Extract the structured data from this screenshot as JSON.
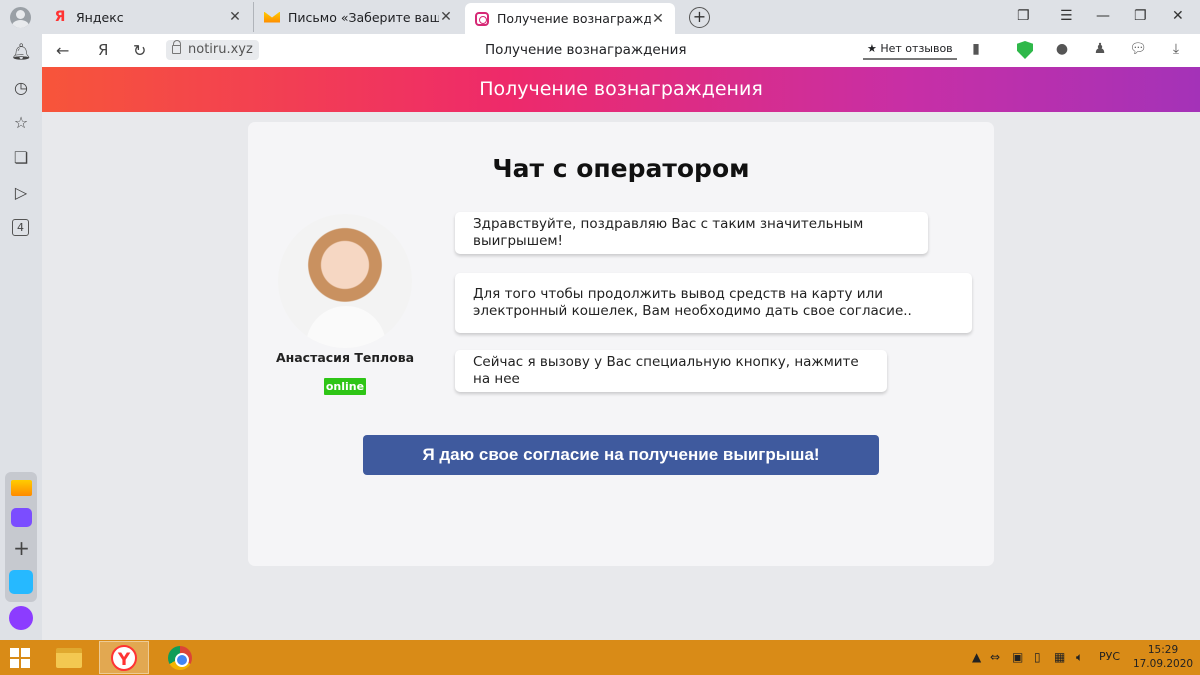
{
  "tabs": [
    {
      "label": "Яндекс",
      "favicon": "yandex-icon"
    },
    {
      "label": "Письмо «Заберите ваш приз»",
      "favicon": "mail-icon"
    },
    {
      "label": "Получение вознаграждения",
      "favicon": "instagram-icon"
    }
  ],
  "addressbar": {
    "url": "notiru.xyz",
    "page_title": "Получение вознаграждения",
    "reviews_label": "★ Нет отзывов"
  },
  "sidebar": {
    "badge_count": "4"
  },
  "page": {
    "banner_title": "Получение вознаграждения",
    "chat_title": "Чат с оператором",
    "operator_name": "Анастасия Теплова",
    "status": "online",
    "messages": [
      "Здравствуйте, поздравляю Вас с таким значительным выигрышем!",
      "Для того чтобы продолжить вывод средств на карту или электронный кошелек, Вам необходимо дать свое согласие..",
      "Сейчас я вызову у Вас специальную кнопку, нажмите на нее"
    ],
    "consent_button": "Я даю свое согласие на получение выигрыша!"
  },
  "taskbar": {
    "language": "РУС",
    "time": "15:29",
    "date": "17.09.2020"
  },
  "colors": {
    "banner_start": "#f7553a",
    "banner_end": "#a432b8",
    "button": "#3f5a9e",
    "online": "#2ec516",
    "taskbar": "#d98b17"
  }
}
